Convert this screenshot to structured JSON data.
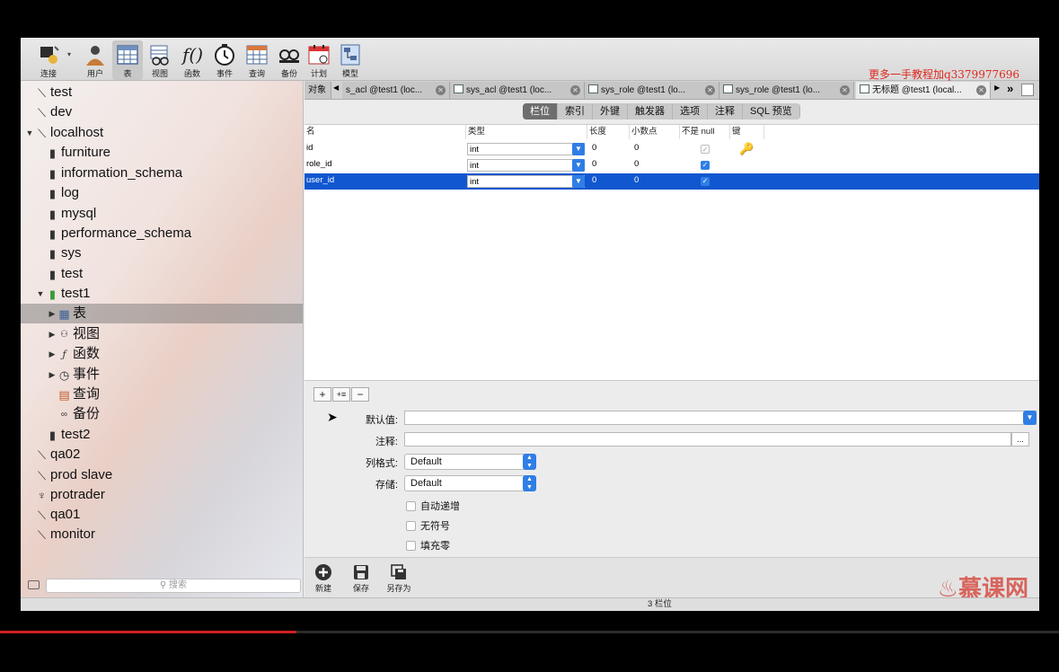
{
  "toolbar": {
    "items": [
      {
        "label": "连接",
        "icon": "connection-icon"
      },
      {
        "label": "用户",
        "icon": "user-icon"
      },
      {
        "label": "表",
        "icon": "table-icon"
      },
      {
        "label": "视图",
        "icon": "view-icon"
      },
      {
        "label": "函数",
        "icon": "function-icon"
      },
      {
        "label": "事件",
        "icon": "event-icon"
      },
      {
        "label": "查询",
        "icon": "query-icon"
      },
      {
        "label": "备份",
        "icon": "backup-icon"
      },
      {
        "label": "计划",
        "icon": "schedule-icon"
      },
      {
        "label": "模型",
        "icon": "model-icon"
      }
    ],
    "watermark": "更多一手教程加q3379977696"
  },
  "sidebar": {
    "items": [
      {
        "label": "test",
        "icon": "connection-icon"
      },
      {
        "label": "dev",
        "icon": "connection-icon"
      },
      {
        "label": "localhost",
        "icon": "connection-icon"
      },
      {
        "label": "furniture",
        "icon": "database-icon"
      },
      {
        "label": "information_schema",
        "icon": "database-icon"
      },
      {
        "label": "log",
        "icon": "database-icon"
      },
      {
        "label": "mysql",
        "icon": "database-icon"
      },
      {
        "label": "performance_schema",
        "icon": "database-icon"
      },
      {
        "label": "sys",
        "icon": "database-icon"
      },
      {
        "label": "test",
        "icon": "database-icon"
      },
      {
        "label": "test1",
        "icon": "database-open-icon"
      },
      {
        "label": "表",
        "icon": "table-icon"
      },
      {
        "label": "视图",
        "icon": "view-icon"
      },
      {
        "label": "函数",
        "icon": "function-icon"
      },
      {
        "label": "事件",
        "icon": "event-icon"
      },
      {
        "label": "查询",
        "icon": "query-icon"
      },
      {
        "label": "备份",
        "icon": "backup-icon"
      },
      {
        "label": "test2",
        "icon": "database-icon"
      },
      {
        "label": "qa02",
        "icon": "connection-icon"
      },
      {
        "label": "prod slave",
        "icon": "connection-icon"
      },
      {
        "label": "protrader",
        "icon": "connection-alt-icon"
      },
      {
        "label": "qa01",
        "icon": "connection-icon"
      },
      {
        "label": "monitor",
        "icon": "connection-icon"
      }
    ],
    "search_placeholder": "搜索"
  },
  "tabs": [
    {
      "label": "对象"
    },
    {
      "label": "s_acl @test1 (loc..."
    },
    {
      "label": "sys_acl @test1 (loc..."
    },
    {
      "label": "sys_role @test1 (lo..."
    },
    {
      "label": "sys_role @test1 (lo..."
    },
    {
      "label": "无标题 @test1 (local..."
    }
  ],
  "subtabs": [
    "栏位",
    "索引",
    "外键",
    "触发器",
    "选项",
    "注释",
    "SQL 预览"
  ],
  "grid": {
    "headers": [
      "名",
      "类型",
      "长度",
      "小数点",
      "不是 null",
      "键"
    ],
    "rows": [
      {
        "name": "id",
        "type": "int",
        "length": "0",
        "decimals": "0",
        "not_null": true,
        "key": true
      },
      {
        "name": "role_id",
        "type": "int",
        "length": "0",
        "decimals": "0",
        "not_null": true,
        "key": false
      },
      {
        "name": "user_id",
        "type": "int",
        "length": "0",
        "decimals": "0",
        "not_null": true,
        "key": false
      }
    ]
  },
  "field_buttons": {
    "add": "+",
    "insert": "+≡",
    "remove": "−"
  },
  "properties": {
    "default_label": "默认值:",
    "comment_label": "注释:",
    "comment_more": "...",
    "column_format_label": "列格式:",
    "column_format_value": "Default",
    "storage_label": "存储:",
    "storage_value": "Default",
    "auto_increment_label": "自动递增",
    "unsigned_label": "无符号",
    "zerofill_label": "填充零"
  },
  "bottom": {
    "new_label": "新建",
    "save_label": "保存",
    "save_as_label": "另存为",
    "logo": "慕课网"
  },
  "status": "3 栏位",
  "colors": {
    "accent": "#1157d0",
    "checkbox": "#2f7ee6",
    "watermark": "#e0281e"
  },
  "video_progress": 0.28
}
